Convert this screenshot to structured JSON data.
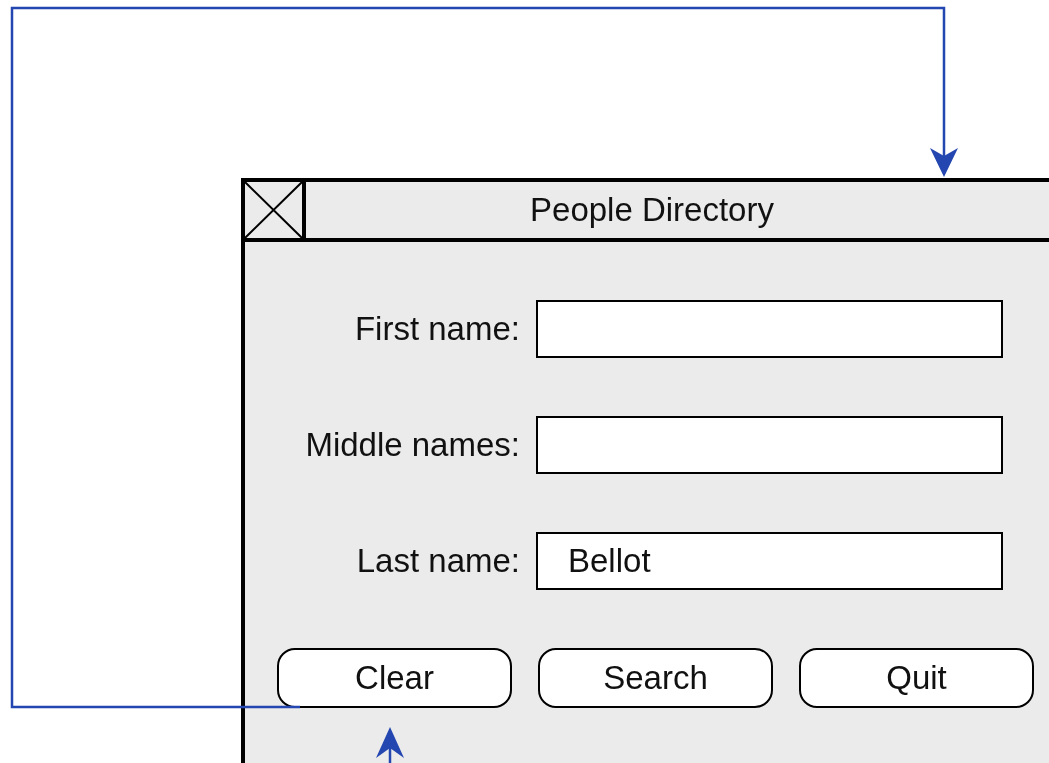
{
  "window": {
    "title": "People Directory"
  },
  "fields": [
    {
      "label": "First name:"
    },
    {
      "label": "Middle names:"
    },
    {
      "label": "Last name:",
      "value": "Bellot"
    }
  ],
  "buttons": [
    "Clear",
    "Search",
    "Quit"
  ]
}
